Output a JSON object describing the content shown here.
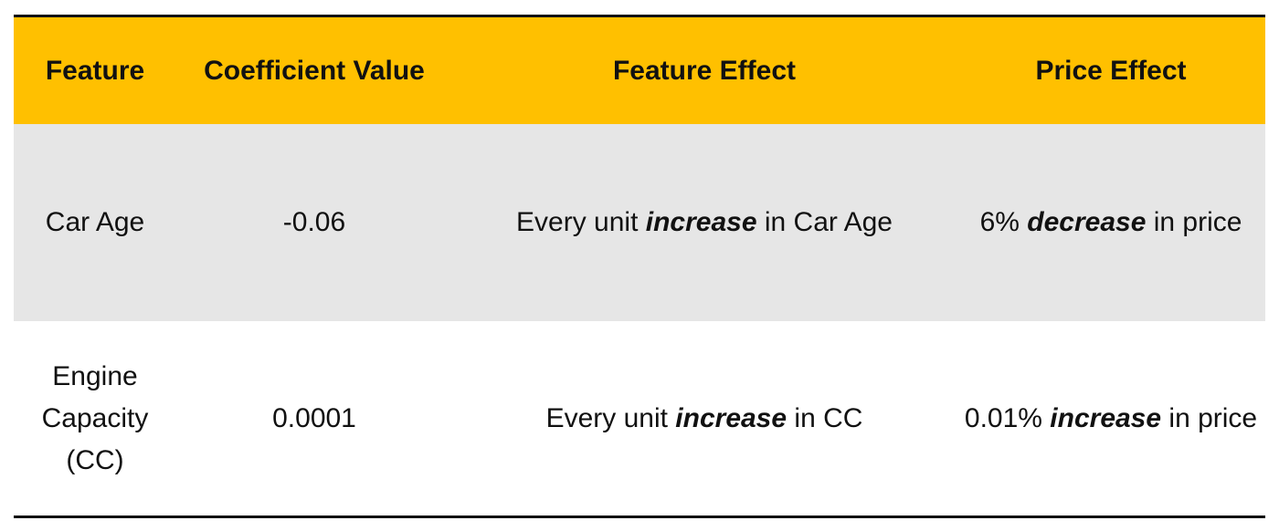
{
  "table": {
    "headers": [
      "Feature",
      "Coefficient Value",
      "Feature Effect",
      "Price Effect"
    ],
    "rows": [
      {
        "feature": "Car Age",
        "coefficient": "-0.06",
        "feature_effect": {
          "before": "Every unit ",
          "emphasis": "increase",
          "after": " in Car Age"
        },
        "price_effect": {
          "before": "6% ",
          "emphasis": "decrease",
          "after": " in price"
        }
      },
      {
        "feature": "Engine Capacity (CC)",
        "coefficient": "0.0001",
        "feature_effect": {
          "before": "Every unit ",
          "emphasis": "increase",
          "after": " in CC"
        },
        "price_effect": {
          "before": "0.01% ",
          "emphasis": "increase",
          "after": " in price"
        }
      }
    ],
    "colors": {
      "header_background": "#FFC000",
      "shaded_row_background": "#E6E6E6",
      "rule_color": "#111111"
    }
  }
}
